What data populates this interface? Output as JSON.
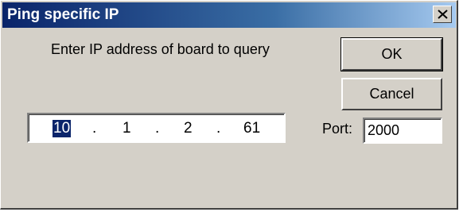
{
  "dialog": {
    "title": "Ping specific IP",
    "prompt": "Enter IP address of board to query",
    "ok_label": "OK",
    "cancel_label": "Cancel",
    "ip": {
      "octets": [
        "10",
        "1",
        "2",
        "61"
      ],
      "separator": ".",
      "selected_octet_index": 0
    },
    "port": {
      "label": "Port:",
      "value": "2000"
    }
  },
  "colors": {
    "face": "#d4d0c8",
    "title_start": "#0a246a",
    "title_end": "#a6caf0",
    "selection": "#0a246a"
  },
  "icons": {
    "close": "close-icon"
  }
}
